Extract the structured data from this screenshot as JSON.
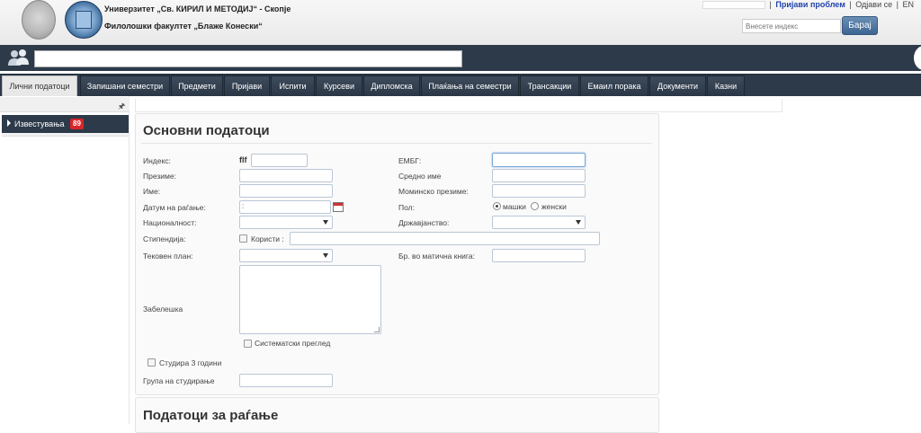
{
  "header": {
    "university": "Универзитет „Св. КИРИЛ И МЕТОДИЈ“ - Скопје",
    "faculty": "Филолошки факултет „Блаже Конески“",
    "report_problem": "Пријави проблем",
    "logout": "Одјави се",
    "lang": "EN",
    "sep1": "|",
    "sep2": "|",
    "sep3": "|",
    "search_placeholder": "Внесете индекс",
    "search_button": "Барај"
  },
  "tabs": [
    {
      "label": "Лични податоци",
      "active": true
    },
    {
      "label": "Запишани семестри"
    },
    {
      "label": "Предмети"
    },
    {
      "label": "Пријави"
    },
    {
      "label": "Испити"
    },
    {
      "label": "Курсеви"
    },
    {
      "label": "Дипломска"
    },
    {
      "label": "Плаќања на семестри"
    },
    {
      "label": "Трансакции"
    },
    {
      "label": "Емаил порака"
    },
    {
      "label": "Документи"
    },
    {
      "label": "Казни"
    }
  ],
  "sidebar": {
    "pin": "🖈",
    "item_label": "Известувања",
    "badge": "89"
  },
  "form": {
    "section_basic": "Основни податоци",
    "section_birth": "Податоци за раѓање",
    "index_label": "Индекс:",
    "index_prefix": "flf",
    "surname_label": "Презиме:",
    "name_label": "Име:",
    "birthdate_label": "Датум на раѓање:",
    "birthdate_value": ":",
    "nationality_label": "Националност:",
    "scholarship_label": "Стипендија:",
    "scholarship_uses": "Користи :",
    "curriculum_label": "Тековен план:",
    "note_label": "Забелешка",
    "checkup_label": "Систематски преглед",
    "three_years_label": "Студира 3 години",
    "group_label": "Група на студирање",
    "embg_label": "ЕМБГ:",
    "middle_name_label": "Средно име",
    "maiden_label": "Моминско презиме:",
    "gender_label": "Пол:",
    "male": "машки",
    "female": "женски",
    "citizenship_label": "Државјанство:",
    "registry_label": "Бр. во матична книга:"
  }
}
